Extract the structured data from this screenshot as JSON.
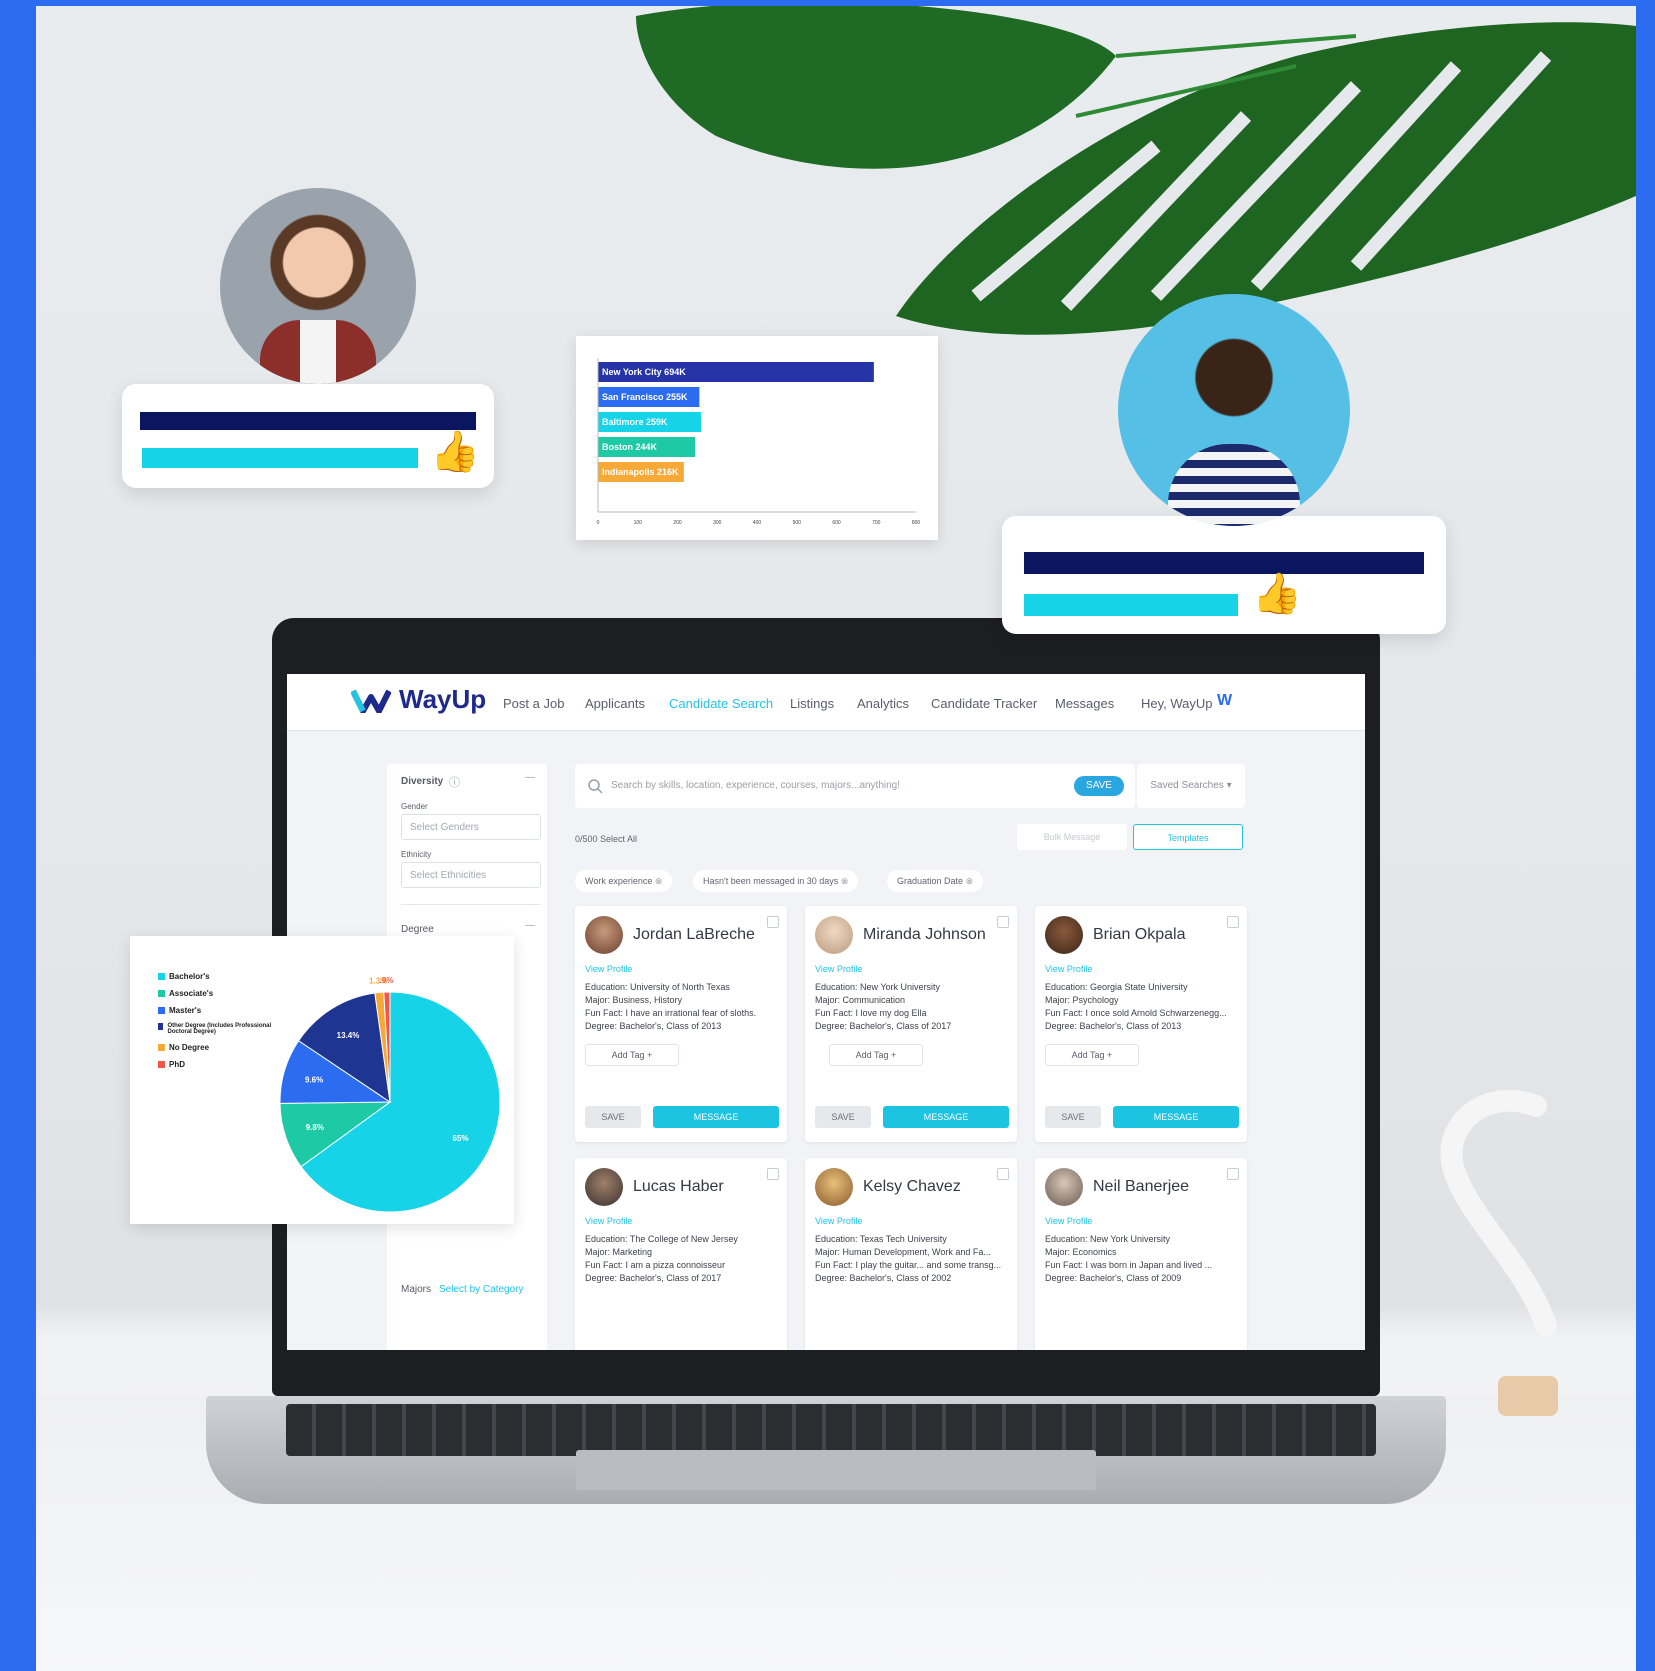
{
  "app": {
    "brand": "WayUp",
    "nav": [
      "Post a Job",
      "Applicants",
      "Candidate Search",
      "Listings",
      "Analytics",
      "Candidate Tracker",
      "Messages",
      "Hey, WayUp"
    ],
    "active_nav": "Candidate Search"
  },
  "sidebar": {
    "diversity_label": "Diversity",
    "gender_label": "Gender",
    "gender_placeholder": "Select Genders",
    "ethnicity_label": "Ethnicity",
    "ethnicity_placeholder": "Select Ethnicities",
    "degree_label": "Degree",
    "majors_label": "Majors",
    "majors_link": "Select by Category"
  },
  "search": {
    "placeholder": "Search by skills, location, experience, courses, majors...anything!",
    "button": "SAVE",
    "saved_searches": "Saved Searches",
    "count_text": "0/500 Select All",
    "bulk_message": "Bulk Message",
    "templates": "Templates",
    "filters": [
      "Work experience",
      "Hasn't been messaged in 30 days",
      "Graduation Date"
    ]
  },
  "candidates": [
    {
      "name": "Jordan LaBreche",
      "view": "View Profile",
      "lines": [
        "Education: University of North Texas",
        "Major: Business, History",
        "Fun Fact: I have an irrational fear of sloths.",
        "Degree: Bachelor's, Class of 2013"
      ],
      "tag": "Add Tag",
      "save": "SAVE",
      "message": "MESSAGE"
    },
    {
      "name": "Miranda Johnson",
      "view": "View Profile",
      "lines": [
        "Education: New York University",
        "Major: Communication",
        "Fun Fact: I love my dog Ella",
        "Degree: Bachelor's, Class of 2017"
      ],
      "tag": "Add Tag",
      "save": "SAVE",
      "message": "MESSAGE"
    },
    {
      "name": "Brian Okpala",
      "view": "View Profile",
      "lines": [
        "Education: Georgia State University",
        "Major: Psychology",
        "Fun Fact: I once sold Arnold Schwarzenegg...",
        "Degree: Bachelor's, Class of 2013"
      ],
      "tag": "Add Tag",
      "save": "SAVE",
      "message": "MESSAGE"
    },
    {
      "name": "Lucas Haber",
      "view": "View Profile",
      "lines": [
        "Education: The College of New Jersey",
        "Major: Marketing",
        "Fun Fact: I am a pizza connoisseur",
        "Degree: Bachelor's, Class of 2017"
      ]
    },
    {
      "name": "Kelsy Chavez",
      "view": "View Profile",
      "lines": [
        "Education: Texas Tech University",
        "Major: Human Development, Work and Fa...",
        "Fun Fact: I play the guitar... and some transg...",
        "Degree: Bachelor's, Class of 2002"
      ]
    },
    {
      "name": "Neil Banerjee",
      "view": "View Profile",
      "lines": [
        "Education: New York University",
        "Major: Economics",
        "Fun Fact: I was born in Japan and lived ...",
        "Degree: Bachelor's, Class of 2009"
      ]
    }
  ],
  "colors": {
    "navy": "#0a1760",
    "cyan": "#17d3e8",
    "blue": "#2c6cf0",
    "thumb": "#7e99f2"
  },
  "icons": [
    "thumbs-up-icon",
    "search-icon",
    "info-icon",
    "chevron-down-icon"
  ],
  "chart_data": [
    {
      "type": "bar",
      "orientation": "horizontal",
      "categories": [
        "New York City",
        "San Francisco",
        "Baltimore",
        "Boston",
        "Indianapolis"
      ],
      "labels": [
        "New York City 694K",
        "San Francisco 255K",
        "Baltimore 259K",
        "Boston 244K",
        "Indianapolis 216K"
      ],
      "values": [
        694,
        255,
        259,
        244,
        216
      ],
      "colors": [
        "#2634a8",
        "#2c6cf0",
        "#17d3e8",
        "#1ec9a6",
        "#f7a937"
      ],
      "xlim": [
        0,
        800
      ],
      "xticks": [
        "0",
        "100",
        "200",
        "300",
        "400",
        "500",
        "600",
        "700",
        "800"
      ]
    },
    {
      "type": "pie",
      "legend_position": "left",
      "series": [
        {
          "name": "Bachelor's",
          "value": 65,
          "label": "65%",
          "color": "#17d3e8"
        },
        {
          "name": "Associate's",
          "value": 9.8,
          "label": "9.8%",
          "color": "#1ec9a6"
        },
        {
          "name": "Master's",
          "value": 9.6,
          "label": "9.6%",
          "color": "#2c6cf0"
        },
        {
          "name": "Other Degree (Includes Professional Doctoral Degree)",
          "value": 13.4,
          "label": "13.4%",
          "color": "#1e3591"
        },
        {
          "name": "No Degree",
          "value": 1.3,
          "label": "1.3%",
          "color": "#f7a937"
        },
        {
          "name": "PhD",
          "value": 0.9,
          "label": ".9%",
          "color": "#f2564b"
        }
      ]
    }
  ]
}
